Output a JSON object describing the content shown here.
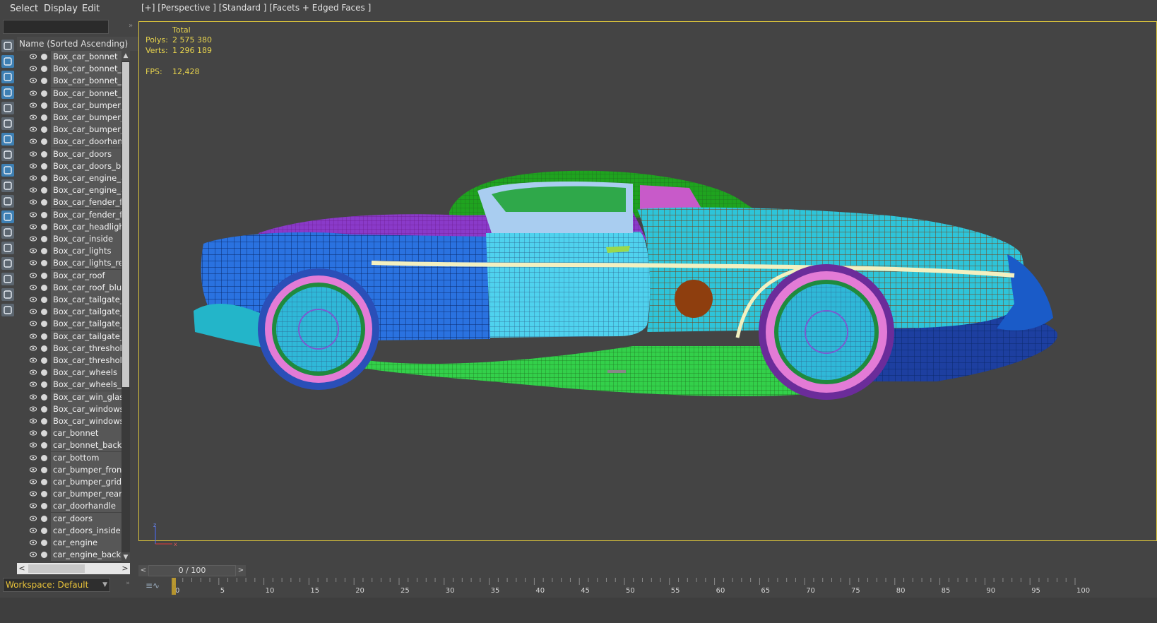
{
  "menu": {
    "select": "Select",
    "display": "Display",
    "edit": "Edit"
  },
  "explorer": {
    "column_header": "Name (Sorted Ascending)",
    "items": [
      "Box_car_bonnet",
      "Box_car_bonnet_ba",
      "Box_car_bonnet_ba",
      "Box_car_bonnet_blu",
      "Box_car_bumper_fro",
      "Box_car_bumper_gr",
      "Box_car_bumper_re",
      "Box_car_doorhandle",
      "Box_car_doors",
      "Box_car_doors_blue",
      "Box_car_engine_and",
      "Box_car_engine_and",
      "Box_car_fender_fro",
      "Box_car_fender_fro",
      "Box_car_headlight_p",
      "Box_car_inside",
      "Box_car_lights",
      "Box_car_lights_red",
      "Box_car_roof",
      "Box_car_roof_blue",
      "Box_car_tailgate_big",
      "Box_car_tailgate_big",
      "Box_car_tailgate_sm",
      "Box_car_tailgate_sm",
      "Box_car_threshold",
      "Box_car_threshold_b",
      "Box_car_wheels",
      "Box_car_wheels_blu",
      "Box_car_win_glass_",
      "Box_car_windows_r",
      "Box_car_windows_r",
      "car_bonnet",
      "car_bonnet_back",
      "car_bottom",
      "car_bumper_front",
      "car_bumper_grid",
      "car_bumper_rear",
      "car_doorhandle",
      "car_doors",
      "car_doors_inside",
      "car_engine",
      "car_engine_back"
    ],
    "workspace": "Workspace: Default"
  },
  "viewport": {
    "label": "[+] [Perspective ] [Standard ] [Facets + Edged Faces ]",
    "stats": {
      "total_label": "Total",
      "polys_label": "Polys:",
      "polys_value": "2 575 380",
      "verts_label": "Verts:",
      "verts_value": "1 296 189",
      "fps_label": "FPS:",
      "fps_value": "12,428"
    },
    "axis": {
      "x": "x",
      "z": "z"
    }
  },
  "timeline": {
    "slider_text": "0 / 100",
    "current_frame": 0,
    "total_frames": 100,
    "tick_labels": [
      "0",
      "5",
      "10",
      "15",
      "20",
      "25",
      "30",
      "35",
      "40",
      "45",
      "50",
      "55",
      "60",
      "65",
      "70",
      "75",
      "80",
      "85",
      "90",
      "95",
      "100"
    ]
  },
  "colors": {
    "viewport_border": "#d8c23c",
    "stats_text": "#e8d44d",
    "workspace_text": "#e8c23a",
    "ui_background": "#444444"
  },
  "icons": {
    "eye": "eye-icon",
    "dot": "render-dot-icon",
    "tools": [
      "display-none-icon",
      "geometry-icon",
      "light-icon",
      "camera-icon",
      "helper-icon",
      "spacewarp-icon",
      "group-icon",
      "xref-icon",
      "bone-icon",
      "container-icon",
      "frozen-icon",
      "visible-icon",
      "layer-icon",
      "selection-set-icon",
      "properties-icon",
      "filter-icon",
      "funnel-icon",
      "clip-icon"
    ]
  }
}
